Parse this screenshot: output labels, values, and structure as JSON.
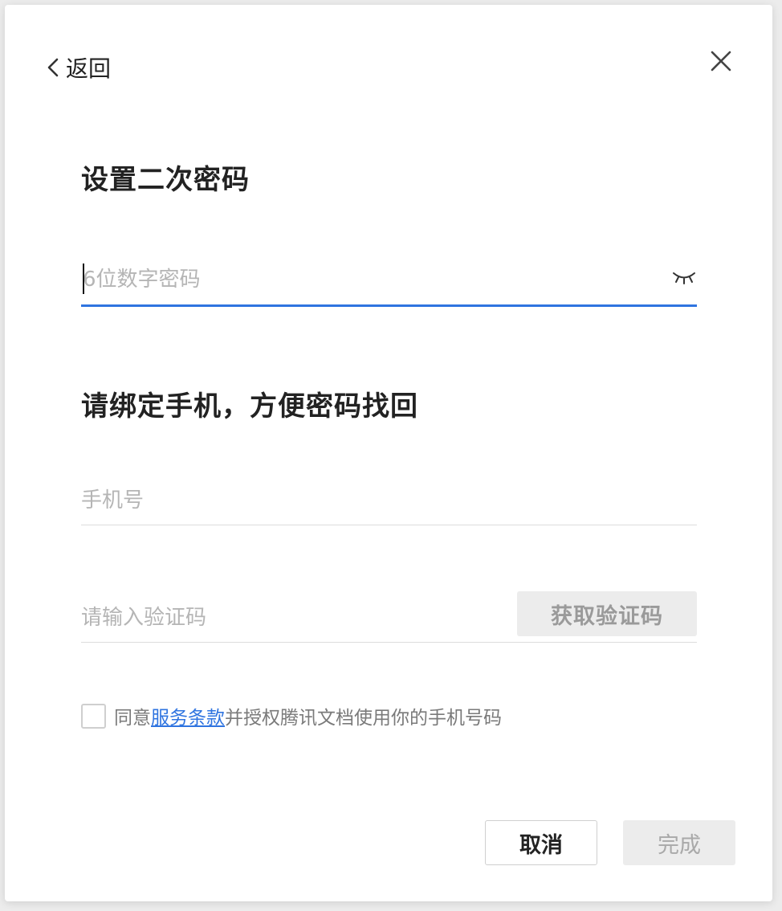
{
  "dialog": {
    "back_label": "返回",
    "close_icon": "close-icon",
    "password_section": {
      "title": "设置二次密码",
      "input_placeholder": "6位数字密码",
      "input_value": "",
      "visibility_icon": "eye-closed-icon"
    },
    "phone_section": {
      "title": "请绑定手机，方便密码找回",
      "phone_placeholder": "手机号",
      "phone_value": "",
      "code_placeholder": "请输入验证码",
      "code_value": "",
      "get_code_label": "获取验证码"
    },
    "agreement": {
      "checked": false,
      "prefix": "同意",
      "link_text": "服务条款",
      "suffix": "并授权腾讯文档使用你的手机号码"
    },
    "buttons": {
      "cancel_label": "取消",
      "done_label": "完成"
    }
  },
  "colors": {
    "accent": "#2f74e0",
    "title_text": "#222222",
    "placeholder": "#b5b5b5",
    "disabled_button_bg": "#ececec"
  }
}
